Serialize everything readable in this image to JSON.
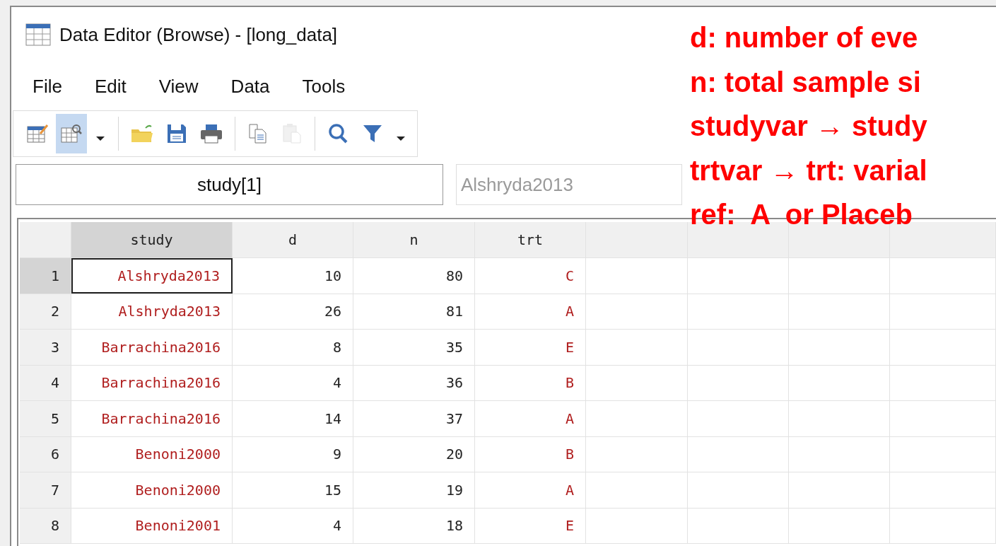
{
  "window": {
    "title": "Data Editor (Browse) - [long_data]"
  },
  "menu": [
    "File",
    "Edit",
    "View",
    "Data",
    "Tools"
  ],
  "toolbar": [
    {
      "buttons": [
        {
          "kind": "edit",
          "selected": false,
          "disabled": false
        },
        {
          "kind": "browse",
          "selected": true,
          "disabled": false
        },
        {
          "kind": "dropdown",
          "selected": false,
          "disabled": false
        }
      ]
    },
    {
      "buttons": [
        {
          "kind": "open",
          "selected": false,
          "disabled": false
        },
        {
          "kind": "save",
          "selected": false,
          "disabled": false
        },
        {
          "kind": "print",
          "selected": false,
          "disabled": false
        }
      ]
    },
    {
      "buttons": [
        {
          "kind": "copy",
          "selected": false,
          "disabled": false
        },
        {
          "kind": "paste",
          "selected": false,
          "disabled": true
        }
      ]
    },
    {
      "buttons": [
        {
          "kind": "search",
          "selected": false,
          "disabled": false
        },
        {
          "kind": "filter",
          "selected": false,
          "disabled": false
        },
        {
          "kind": "dropdown",
          "selected": false,
          "disabled": false
        }
      ]
    }
  ],
  "cell_name": "study[1]",
  "cell_value": "Alshryda2013",
  "table": {
    "columns": [
      {
        "label": "study",
        "selected": true
      },
      {
        "label": "d",
        "selected": false
      },
      {
        "label": "n",
        "selected": false
      },
      {
        "label": "trt",
        "selected": false
      }
    ],
    "rows": [
      {
        "number": "1",
        "selected": true,
        "cells": [
          "Alshryda2013",
          "10",
          "80",
          "C"
        ]
      },
      {
        "number": "2",
        "selected": false,
        "cells": [
          "Alshryda2013",
          "26",
          "81",
          "A"
        ]
      },
      {
        "number": "3",
        "selected": false,
        "cells": [
          "Barrachina2016",
          "8",
          "35",
          "E"
        ]
      },
      {
        "number": "4",
        "selected": false,
        "cells": [
          "Barrachina2016",
          "4",
          "36",
          "B"
        ]
      },
      {
        "number": "5",
        "selected": false,
        "cells": [
          "Barrachina2016",
          "14",
          "37",
          "A"
        ]
      },
      {
        "number": "6",
        "selected": false,
        "cells": [
          "Benoni2000",
          "9",
          "20",
          "B"
        ]
      },
      {
        "number": "7",
        "selected": false,
        "cells": [
          "Benoni2000",
          "15",
          "19",
          "A"
        ]
      },
      {
        "number": "8",
        "selected": false,
        "cells": [
          "Benoni2001",
          "4",
          "18",
          "E"
        ]
      }
    ]
  },
  "annotations": [
    "d: number of eve",
    "n: total sample si",
    "studyvar → study",
    "trtvar → trt: varial",
    "ref:  A  or Placeb"
  ]
}
